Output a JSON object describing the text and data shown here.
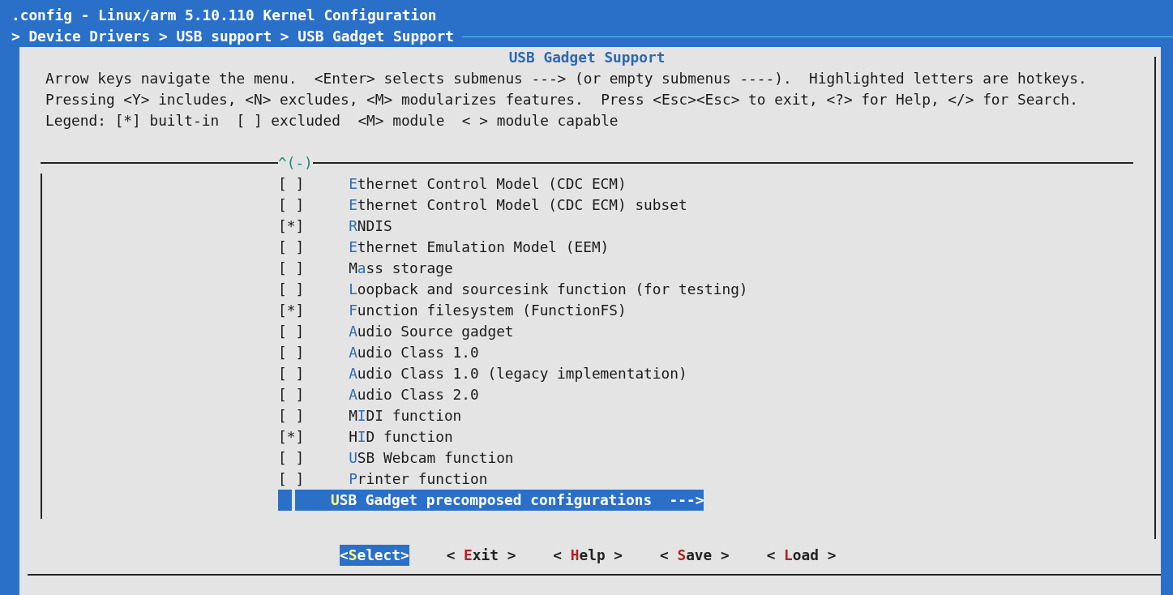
{
  "window": {
    "title": ".config - Linux/arm 5.10.110 Kernel Configuration",
    "breadcrumb": "> Device Drivers > USB support > USB Gadget Support"
  },
  "dialog": {
    "title": "USB Gadget Support",
    "help_lines": [
      "Arrow keys navigate the menu.  <Enter> selects submenus ---> (or empty submenus ----).  Highlighted letters are hotkeys.",
      "Pressing <Y> includes, <N> excludes, <M> modularizes features.  Press <Esc><Esc> to exit, <?> for Help, </> for Search.",
      "Legend: [*] built-in  [ ] excluded  <M> module  < > module capable"
    ],
    "scroll_indicator": "^(-)",
    "check_marks": {
      "on": "[*]",
      "off": "[ ]"
    },
    "items": [
      {
        "kind": "bool",
        "checked": false,
        "hotkey": "E",
        "post": "thernet Control Model (CDC ECM)",
        "selected": false
      },
      {
        "kind": "bool",
        "checked": false,
        "hotkey": "E",
        "post": "thernet Control Model (CDC ECM) subset",
        "selected": false
      },
      {
        "kind": "bool",
        "checked": true,
        "hotkey": "R",
        "post": "NDIS",
        "selected": false
      },
      {
        "kind": "bool",
        "checked": false,
        "hotkey": "E",
        "post": "thernet Emulation Model (EEM)",
        "selected": false
      },
      {
        "kind": "bool",
        "checked": false,
        "pre": "M",
        "hotkey": "a",
        "post": "ss storage",
        "selected": false
      },
      {
        "kind": "bool",
        "checked": false,
        "hotkey": "L",
        "post": "oopback and sourcesink function (for testing)",
        "selected": false
      },
      {
        "kind": "bool",
        "checked": true,
        "hotkey": "F",
        "post": "unction filesystem (FunctionFS)",
        "selected": false
      },
      {
        "kind": "bool",
        "checked": false,
        "hotkey": "A",
        "post": "udio Source gadget",
        "selected": false
      },
      {
        "kind": "bool",
        "checked": false,
        "hotkey": "A",
        "post": "udio Class 1.0",
        "selected": false
      },
      {
        "kind": "bool",
        "checked": false,
        "hotkey": "A",
        "post": "udio Class 1.0 (legacy implementation)",
        "selected": false
      },
      {
        "kind": "bool",
        "checked": false,
        "hotkey": "A",
        "post": "udio Class 2.0",
        "selected": false
      },
      {
        "kind": "bool",
        "checked": false,
        "pre": "M",
        "hotkey": "I",
        "post": "DI function",
        "selected": false
      },
      {
        "kind": "bool",
        "checked": true,
        "pre": "H",
        "hotkey": "I",
        "post": "D function",
        "selected": false
      },
      {
        "kind": "bool",
        "checked": false,
        "hotkey": "U",
        "post": "SB Webcam function",
        "selected": false
      },
      {
        "kind": "bool",
        "checked": false,
        "hotkey": "P",
        "post": "rinter function",
        "selected": false
      },
      {
        "kind": "menu",
        "hotkey": "U",
        "post": "SB Gadget precomposed configurations  --->",
        "selected": true
      }
    ],
    "buttons": [
      {
        "pre": "<",
        "hotkey": "S",
        "post": "elect>",
        "selected": true
      },
      {
        "pre": "< ",
        "hotkey": "E",
        "post": "xit >",
        "selected": false
      },
      {
        "pre": "< ",
        "hotkey": "H",
        "post": "elp >",
        "selected": false
      },
      {
        "pre": "< ",
        "hotkey": "S",
        "post": "ave >",
        "selected": false
      },
      {
        "pre": "< ",
        "hotkey": "L",
        "post": "oad >",
        "selected": false
      }
    ]
  }
}
